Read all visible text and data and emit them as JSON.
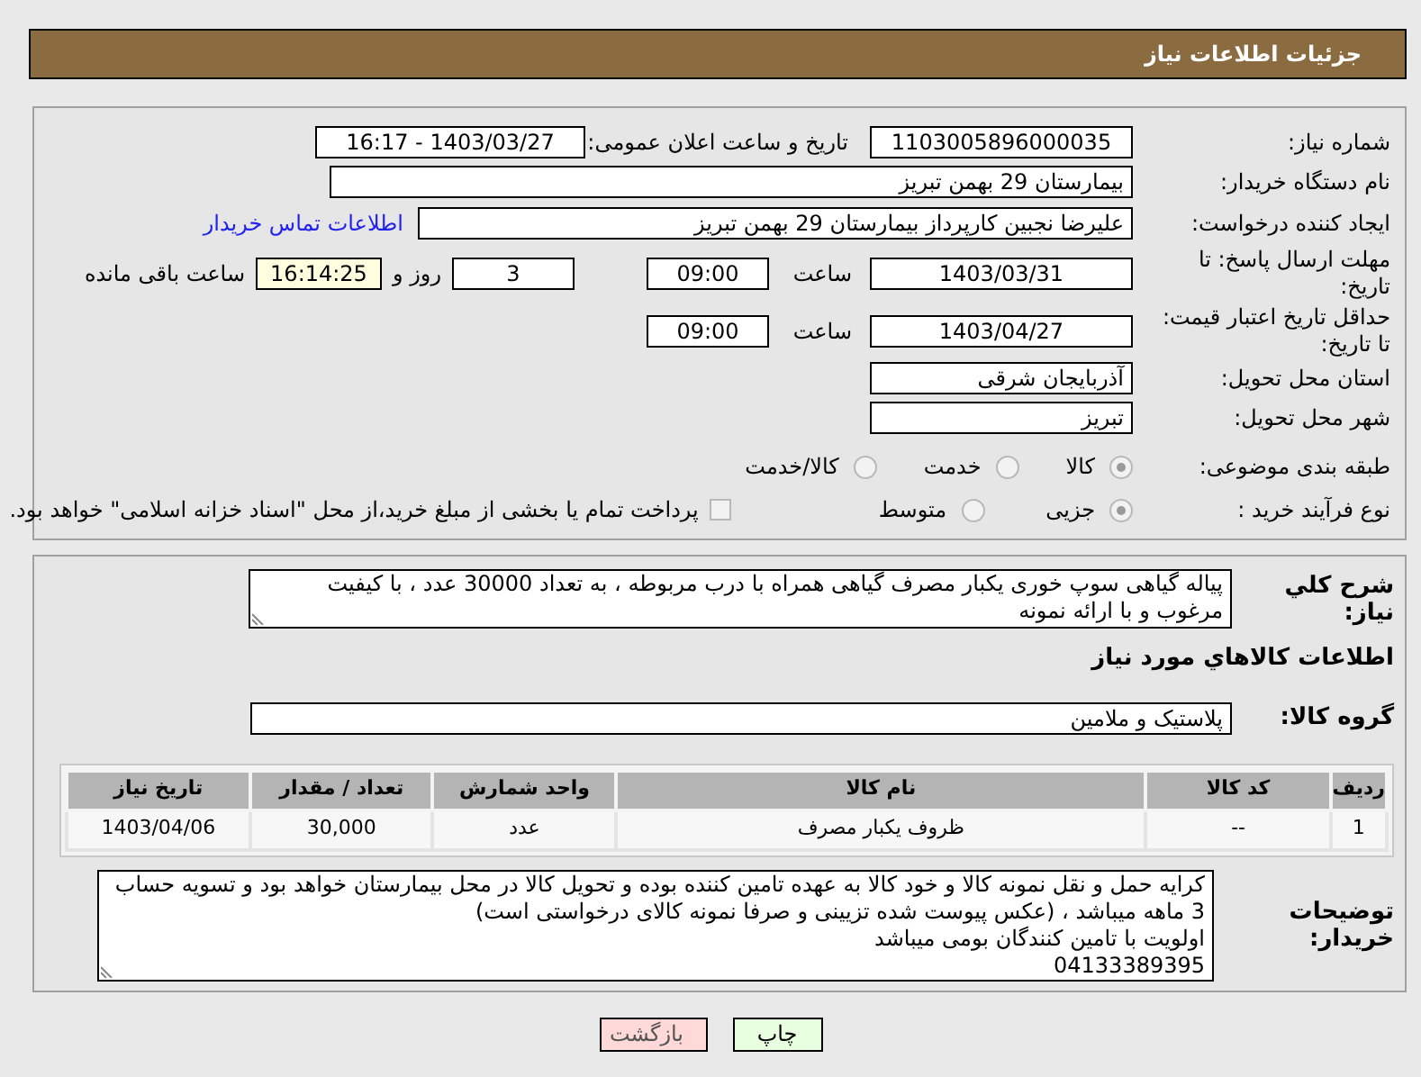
{
  "header": {
    "title": "جزئیات اطلاعات نیاز"
  },
  "need_info": {
    "need_number": {
      "label": "شماره نیاز:",
      "value": "1103005896000035"
    },
    "announce_datetime": {
      "label": "تاریخ و ساعت اعلان عمومی:",
      "value": "1403/03/27 - 16:17"
    },
    "buyer_org": {
      "label": "نام دستگاه خریدار:",
      "value": "بیمارستان 29 بهمن تبریز"
    },
    "requester": {
      "label": "ایجاد کننده درخواست:",
      "value": "علیرضا نجبین کارپرداز بیمارستان 29 بهمن تبریز",
      "link": "اطلاعات تماس خریدار"
    },
    "response_deadline": {
      "label": "مهلت ارسال پاسخ: تا تاریخ:",
      "date": "1403/03/31",
      "time_label": "ساعت",
      "time": "09:00",
      "days": "3",
      "days_label": "روز و",
      "remaining": "16:14:25",
      "remaining_label": "ساعت باقی مانده"
    },
    "price_validity": {
      "label": "حداقل تاریخ اعتبار قیمت: تا تاریخ:",
      "date": "1403/04/27",
      "time_label": "ساعت",
      "time": "09:00"
    },
    "province": {
      "label": "استان محل تحویل:",
      "value": "آذربایجان شرقی"
    },
    "city": {
      "label": "شهر محل تحویل:",
      "value": "تبریز"
    },
    "category": {
      "label": "طبقه بندی موضوعی:",
      "options": [
        {
          "label": "كالا",
          "selected": true
        },
        {
          "label": "خدمت",
          "selected": false
        },
        {
          "label": "كالا/خدمت",
          "selected": false
        }
      ]
    },
    "purchase_type": {
      "label": "نوع فرآیند خرید :",
      "options": [
        {
          "label": "جزیی",
          "selected": true
        },
        {
          "label": "متوسط",
          "selected": false
        }
      ],
      "payment": {
        "checked": false,
        "label": "پرداخت تمام یا بخشی از مبلغ خرید،از محل \"اسناد خزانه اسلامی\" خواهد بود."
      }
    }
  },
  "details": {
    "description": {
      "label": "شرح کلي نیاز:",
      "value": "پیاله گیاهی سوپ خوری یکبار مصرف گیاهی همراه با درب مربوطه ، به تعداد 30000 عدد ، با کیفیت مرغوب و با ارائه نمونه"
    },
    "goods_heading": "اطلاعات کالاهاي مورد نیاز",
    "goods_group": {
      "label": "گروه کالا:",
      "value": "پلاستیک و ملامین"
    },
    "table": {
      "columns": [
        "ردیف",
        "کد کالا",
        "نام کالا",
        "واحد شمارش",
        "تعداد / مقدار",
        "تاریخ نیاز"
      ],
      "rows": [
        [
          "1",
          "--",
          "ظروف یکبار مصرف",
          "عدد",
          "30,000",
          "1403/04/06"
        ]
      ]
    },
    "buyer_notes": {
      "label": "توضیحات خریدار:",
      "value": "کرایه حمل و نقل نمونه کالا و خود کالا به عهده تامین کننده بوده و تحویل کالا در محل بیمارستان خواهد بود و تسویه حساب 3 ماهه میباشد ، (عکس پیوست شده تزیینی و صرفا نمونه کالای درخواستی است)\nاولویت با تامین کنندگان بومی میباشد\n04133389395"
    }
  },
  "buttons": [
    {
      "label": "چاپ",
      "kind": "print"
    },
    {
      "label": "بازگشت",
      "kind": "back"
    }
  ]
}
